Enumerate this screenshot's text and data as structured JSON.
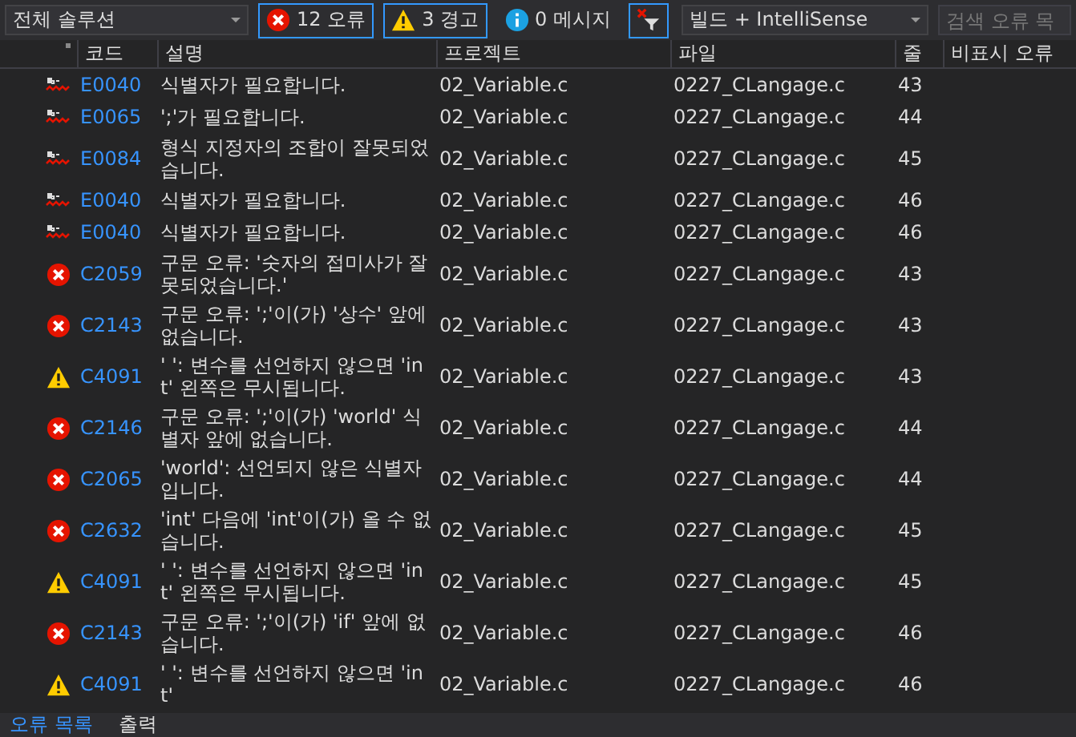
{
  "toolbar": {
    "scope": "전체 솔루션",
    "filters": [
      {
        "kind": "error",
        "label": "12 오류",
        "selected": true
      },
      {
        "kind": "warning",
        "label": "3 경고",
        "selected": true
      },
      {
        "kind": "message",
        "label": "0 메시지",
        "selected": false
      }
    ],
    "filter_toggle": {
      "selected": true
    },
    "source": "빌드 + IntelliSense",
    "search": {
      "placeholder": "검색 오류 목"
    }
  },
  "table": {
    "columns": [
      "코드",
      "설명",
      "프로젝트",
      "파일",
      "줄",
      "비표시 오류"
    ],
    "rows": [
      {
        "kind": "intellisense",
        "code": "E0040",
        "description": "식별자가 필요합니다.",
        "project": "02_Variable.c",
        "file": "0227_CLangage.c",
        "line": "43"
      },
      {
        "kind": "intellisense",
        "code": "E0065",
        "description": "';'가 필요합니다.",
        "project": "02_Variable.c",
        "file": "0227_CLangage.c",
        "line": "44"
      },
      {
        "kind": "intellisense",
        "code": "E0084",
        "description": "형식 지정자의 조합이 잘못되었습니다.",
        "project": "02_Variable.c",
        "file": "0227_CLangage.c",
        "line": "45"
      },
      {
        "kind": "intellisense",
        "code": "E0040",
        "description": "식별자가 필요합니다.",
        "project": "02_Variable.c",
        "file": "0227_CLangage.c",
        "line": "46"
      },
      {
        "kind": "intellisense",
        "code": "E0040",
        "description": "식별자가 필요합니다.",
        "project": "02_Variable.c",
        "file": "0227_CLangage.c",
        "line": "46"
      },
      {
        "kind": "error",
        "code": "C2059",
        "description": "구문 오류: '숫자의 접미사가 잘못되었습니다.'",
        "project": "02_Variable.c",
        "file": "0227_CLangage.c",
        "line": "43"
      },
      {
        "kind": "error",
        "code": "C2143",
        "description": "구문 오류: ';'이(가) '상수' 앞에 없습니다.",
        "project": "02_Variable.c",
        "file": "0227_CLangage.c",
        "line": "43"
      },
      {
        "kind": "warning",
        "code": "C4091",
        "description": "' ': 변수를 선언하지 않으면 'int' 왼쪽은 무시됩니다.",
        "project": "02_Variable.c",
        "file": "0227_CLangage.c",
        "line": "43"
      },
      {
        "kind": "error",
        "code": "C2146",
        "description": "구문 오류: ';'이(가) 'world' 식별자 앞에 없습니다.",
        "project": "02_Variable.c",
        "file": "0227_CLangage.c",
        "line": "44"
      },
      {
        "kind": "error",
        "code": "C2065",
        "description": "'world': 선언되지 않은 식별자입니다.",
        "project": "02_Variable.c",
        "file": "0227_CLangage.c",
        "line": "44"
      },
      {
        "kind": "error",
        "code": "C2632",
        "description": "'int' 다음에 'int'이(가) 올 수 없습니다.",
        "project": "02_Variable.c",
        "file": "0227_CLangage.c",
        "line": "45"
      },
      {
        "kind": "warning",
        "code": "C4091",
        "description": "' ': 변수를 선언하지 않으면 'int' 왼쪽은 무시됩니다.",
        "project": "02_Variable.c",
        "file": "0227_CLangage.c",
        "line": "45"
      },
      {
        "kind": "error",
        "code": "C2143",
        "description": "구문 오류: ';'이(가) 'if' 앞에 없습니다.",
        "project": "02_Variable.c",
        "file": "0227_CLangage.c",
        "line": "46"
      },
      {
        "kind": "warning",
        "code": "C4091",
        "description": "' ': 변수를 선언하지 않으면 'int'",
        "project": "02_Variable.c",
        "file": "0227_CLangage.c",
        "line": "46"
      }
    ]
  },
  "bottom_tabs": [
    {
      "label": "오류 목록",
      "selected": true
    },
    {
      "label": "출력",
      "selected": false
    }
  ]
}
